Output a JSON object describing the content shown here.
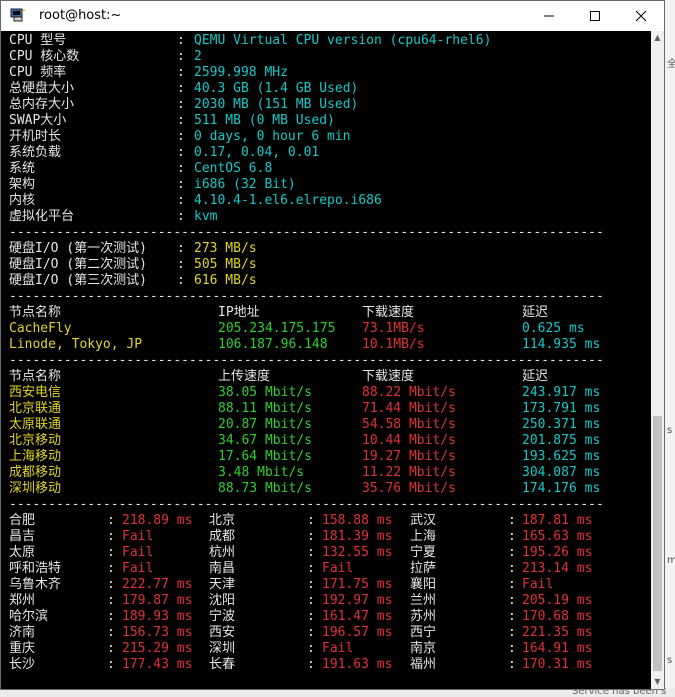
{
  "window": {
    "title": "root@host:~"
  },
  "sysinfo": [
    {
      "label": "CPU 型号",
      "value": "QEMU Virtual CPU version (cpu64-rhel6)"
    },
    {
      "label": "CPU 核心数",
      "value": "2"
    },
    {
      "label": "CPU 频率",
      "value": "2599.998 MHz"
    },
    {
      "label": "总硬盘大小",
      "value": "40.3 GB (1.4 GB Used)"
    },
    {
      "label": "总内存大小",
      "value": "2030 MB (151 MB Used)"
    },
    {
      "label": "SWAP大小",
      "value": "511 MB (0 MB Used)"
    },
    {
      "label": "开机时长",
      "value": "0 days, 0 hour 6 min"
    },
    {
      "label": "系统负载",
      "value": "0.17, 0.04, 0.01"
    },
    {
      "label": "系统",
      "value": "CentOS 6.8"
    },
    {
      "label": "架构",
      "value": "i686 (32 Bit)"
    },
    {
      "label": "内核",
      "value": "4.10.4-1.el6.elrepo.i686"
    },
    {
      "label": "虚拟化平台",
      "value": "kvm"
    }
  ],
  "separator": "--------------------------------------------------------------------------------------------------------------------",
  "colon": ":",
  "disk": [
    {
      "label": "硬盘I/O (第一次测试)",
      "value": "273 MB/s"
    },
    {
      "label": "硬盘I/O (第二次测试)",
      "value": "505 MB/s"
    },
    {
      "label": "硬盘I/O (第三次测试)",
      "value": "616 MB/s"
    }
  ],
  "download": {
    "headers": [
      "节点名称",
      "IP地址",
      "下载速度",
      "延迟"
    ],
    "rows": [
      {
        "name": "CacheFly",
        "ip": "205.234.175.175",
        "speed": "73.1MB/s",
        "latency": "0.625 ms"
      },
      {
        "name": "Linode, Tokyo, JP",
        "ip": "106.187.96.148",
        "speed": "10.1MB/s",
        "latency": "114.935 ms"
      }
    ]
  },
  "china": {
    "headers": [
      "节点名称",
      "上传速度",
      "下载速度",
      "延迟"
    ],
    "rows": [
      {
        "name": "西安电信",
        "up": "38.05 Mbit/s",
        "down": "88.22 Mbit/s",
        "latency": "243.917 ms"
      },
      {
        "name": "北京联通",
        "up": "88.11 Mbit/s",
        "down": "71.44 Mbit/s",
        "latency": "173.791 ms"
      },
      {
        "name": "太原联通",
        "up": "20.87 Mbit/s",
        "down": "54.58 Mbit/s",
        "latency": "250.371 ms"
      },
      {
        "name": "北京移动",
        "up": "34.67 Mbit/s",
        "down": "10.44 Mbit/s",
        "latency": "201.875 ms"
      },
      {
        "name": "上海移动",
        "up": "17.64 Mbit/s",
        "down": "19.27 Mbit/s",
        "latency": "193.625 ms"
      },
      {
        "name": "成都移动",
        "up": "3.48 Mbit/s",
        "down": "11.22 Mbit/s",
        "latency": "304.087 ms"
      },
      {
        "name": "深圳移动",
        "up": "88.73 Mbit/s",
        "down": "35.76 Mbit/s",
        "latency": "174.176 ms"
      }
    ]
  },
  "ping": [
    [
      {
        "city": "合肥",
        "value": "218.89 ms"
      },
      {
        "city": "北京",
        "value": "158.88 ms"
      },
      {
        "city": "武汉",
        "value": "187.81 ms"
      }
    ],
    [
      {
        "city": "昌吉",
        "value": "Fail"
      },
      {
        "city": "成都",
        "value": "181.39 ms"
      },
      {
        "city": "上海",
        "value": "165.63 ms"
      }
    ],
    [
      {
        "city": "太原",
        "value": "Fail"
      },
      {
        "city": "杭州",
        "value": "132.55 ms"
      },
      {
        "city": "宁夏",
        "value": "195.26 ms"
      }
    ],
    [
      {
        "city": "呼和浩特",
        "value": "Fail"
      },
      {
        "city": "南昌",
        "value": "Fail"
      },
      {
        "city": "拉萨",
        "value": "213.14 ms"
      }
    ],
    [
      {
        "city": "乌鲁木齐",
        "value": "222.77 ms"
      },
      {
        "city": "天津",
        "value": "171.75 ms"
      },
      {
        "city": "襄阳",
        "value": "Fail"
      }
    ],
    [
      {
        "city": "郑州",
        "value": "179.87 ms"
      },
      {
        "city": "沈阳",
        "value": "192.97 ms"
      },
      {
        "city": "兰州",
        "value": "205.19 ms"
      }
    ],
    [
      {
        "city": "哈尔滨",
        "value": "189.93 ms"
      },
      {
        "city": "宁波",
        "value": "161.47 ms"
      },
      {
        "city": "苏州",
        "value": "170.68 ms"
      }
    ],
    [
      {
        "city": "济南",
        "value": "156.73 ms"
      },
      {
        "city": "西安",
        "value": "196.57 ms"
      },
      {
        "city": "西宁",
        "value": "221.35 ms"
      }
    ],
    [
      {
        "city": "重庆",
        "value": "215.29 ms"
      },
      {
        "city": "深圳",
        "value": "Fail"
      },
      {
        "city": "南京",
        "value": "164.91 ms"
      }
    ],
    [
      {
        "city": "长沙",
        "value": "177.43 ms"
      },
      {
        "city": "长春",
        "value": "191.63 ms"
      },
      {
        "city": "福州",
        "value": "170.31 ms"
      }
    ]
  ],
  "background": {
    "status_text": "Service has been s",
    "frag_1": "全",
    "frag_2": "s",
    "frag_3": "m",
    "frag_4": "s"
  },
  "colors": {
    "cyan": "#14c8c8",
    "yellow": "#e2d42a",
    "green": "#2ed02e",
    "red": "#e03232"
  }
}
